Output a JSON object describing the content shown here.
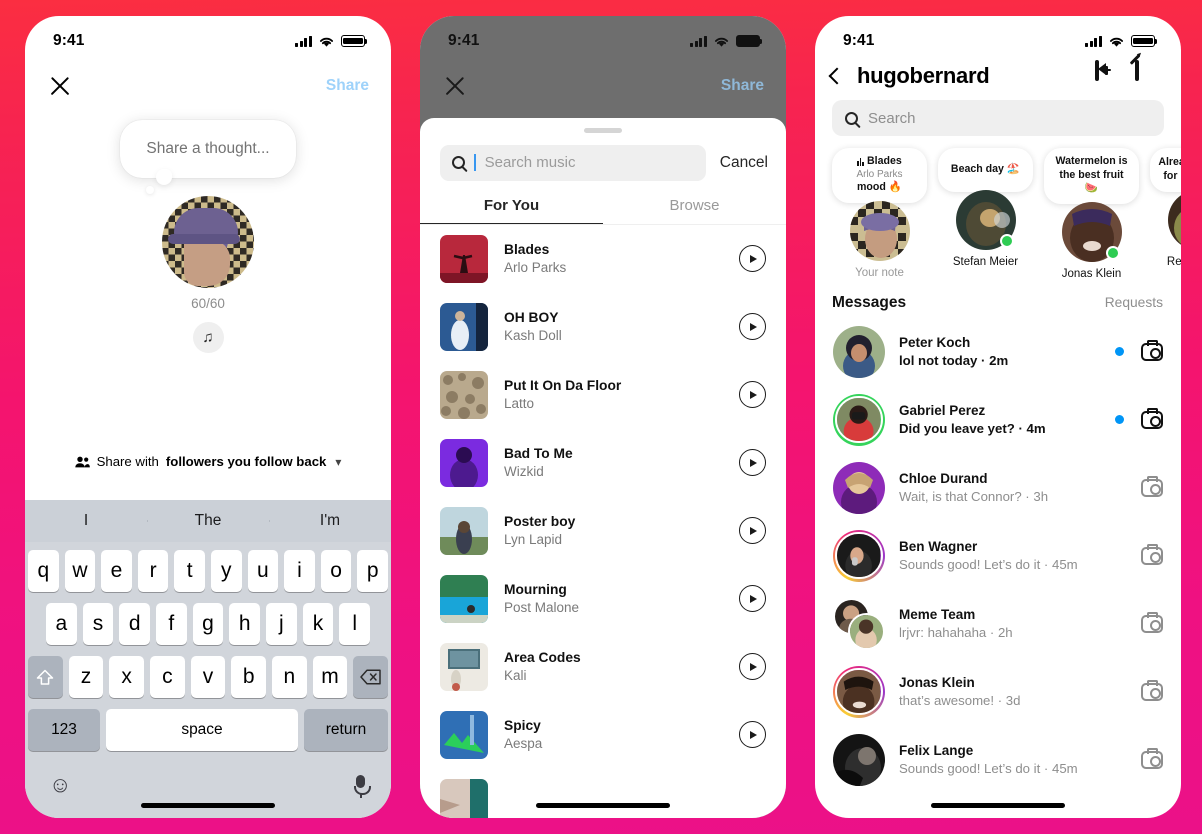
{
  "background": {
    "top_color": "#FB2E41",
    "bottom_color": "#EB1188"
  },
  "phone1": {
    "name": "note-composer",
    "statusbar": {
      "time": "9:41",
      "signal_icon": "cellular-bars-icon",
      "wifi_icon": "wifi-icon",
      "battery_icon": "battery-full-icon"
    },
    "close_label": "close-icon",
    "share_label": "Share",
    "note_placeholder": "Share a thought...",
    "char_counter": "60/60",
    "music_icon": "music-note-icon",
    "audience": {
      "prefix": "Share with",
      "bold": "followers you follow back",
      "chevron": "chevron-down-icon"
    },
    "keyboard": {
      "predictions": [
        "I",
        "The",
        "I'm"
      ],
      "row1": [
        "q",
        "w",
        "e",
        "r",
        "t",
        "y",
        "u",
        "i",
        "o",
        "p"
      ],
      "row2": [
        "a",
        "s",
        "d",
        "f",
        "g",
        "h",
        "j",
        "k",
        "l"
      ],
      "row3": [
        "z",
        "x",
        "c",
        "v",
        "b",
        "n",
        "m"
      ],
      "shift_icon": "shift-icon",
      "backspace_icon": "backspace-icon",
      "numbers_label": "123",
      "space_label": "space",
      "return_label": "return",
      "emoji_icon": "emoji-icon",
      "mic_icon": "microphone-icon"
    }
  },
  "phone2": {
    "name": "music-picker",
    "statusbar": {
      "time": "9:41"
    },
    "close_label": "close-icon",
    "share_label": "Share",
    "search": {
      "placeholder": "Search music",
      "value": "",
      "icon": "search-icon"
    },
    "cancel_label": "Cancel",
    "tabs": [
      {
        "label": "For You",
        "active": true
      },
      {
        "label": "Browse",
        "active": false
      }
    ],
    "songs": [
      {
        "title": "Blades",
        "artist": "Arlo Parks",
        "cover": "c1"
      },
      {
        "title": "OH BOY",
        "artist": "Kash Doll",
        "cover": "c2"
      },
      {
        "title": "Put It On Da Floor",
        "artist": "Latto",
        "cover": "c3"
      },
      {
        "title": "Bad To Me",
        "artist": "Wizkid",
        "cover": "c4"
      },
      {
        "title": "Poster boy",
        "artist": "Lyn Lapid",
        "cover": "c5"
      },
      {
        "title": "Mourning",
        "artist": "Post Malone",
        "cover": "c6"
      },
      {
        "title": "Area Codes",
        "artist": "Kali",
        "cover": "c7"
      },
      {
        "title": "Spicy",
        "artist": "Aespa",
        "cover": "c8"
      }
    ],
    "play_icon": "play-circle-icon"
  },
  "phone3": {
    "name": "direct-inbox",
    "statusbar": {
      "time": "9:41"
    },
    "back_icon": "chevron-left-icon",
    "username": "hugobernard",
    "video_call_icon": "video-call-add-icon",
    "compose_icon": "compose-icon",
    "search": {
      "placeholder": "Search",
      "icon": "search-icon"
    },
    "notes": [
      {
        "song": "Blades",
        "artist": "Arlo Parks",
        "mood": "mood 🔥",
        "name": "Your note",
        "self": true,
        "online": false
      },
      {
        "text": "Beach day 🏖️",
        "name": "Stefan Meier",
        "self": false,
        "online": true
      },
      {
        "text": "Watermelon is the best fruit 🍉",
        "name": "Jonas Klein",
        "self": false,
        "online": true
      },
      {
        "text": "Already excited for halloween",
        "name": "Ren Tanaka",
        "self": false,
        "online": false
      }
    ],
    "messages_label": "Messages",
    "requests_label": "Requests",
    "conversations": [
      {
        "name": "Peter Koch",
        "snippet": "lol not today · 2m",
        "unread": true,
        "ring": "none",
        "avatar": "a1"
      },
      {
        "name": "Gabriel Perez",
        "snippet": "Did you leave yet? · 4m",
        "unread": true,
        "ring": "green",
        "avatar": "a2"
      },
      {
        "name": "Chloe Durand",
        "snippet": "Wait, is that Connor? · 3h",
        "unread": false,
        "ring": "none",
        "avatar": "a3"
      },
      {
        "name": "Ben Wagner",
        "snippet": "Sounds good! Let’s do it · 45m",
        "unread": false,
        "ring": "story",
        "avatar": "a4"
      },
      {
        "name": "Meme Team",
        "snippet": "lrjvr: hahahaha · 2h",
        "unread": false,
        "ring": "none",
        "avatar": "group"
      },
      {
        "name": "Jonas Klein",
        "snippet": "that’s awesome! · 3d",
        "unread": false,
        "ring": "story",
        "avatar": "a5"
      },
      {
        "name": "Felix Lange",
        "snippet": "Sounds good! Let’s do it · 45m",
        "unread": false,
        "ring": "none",
        "avatar": "a6"
      }
    ],
    "camera_icon": "camera-icon",
    "unread_dot_color": "#0095F6"
  }
}
